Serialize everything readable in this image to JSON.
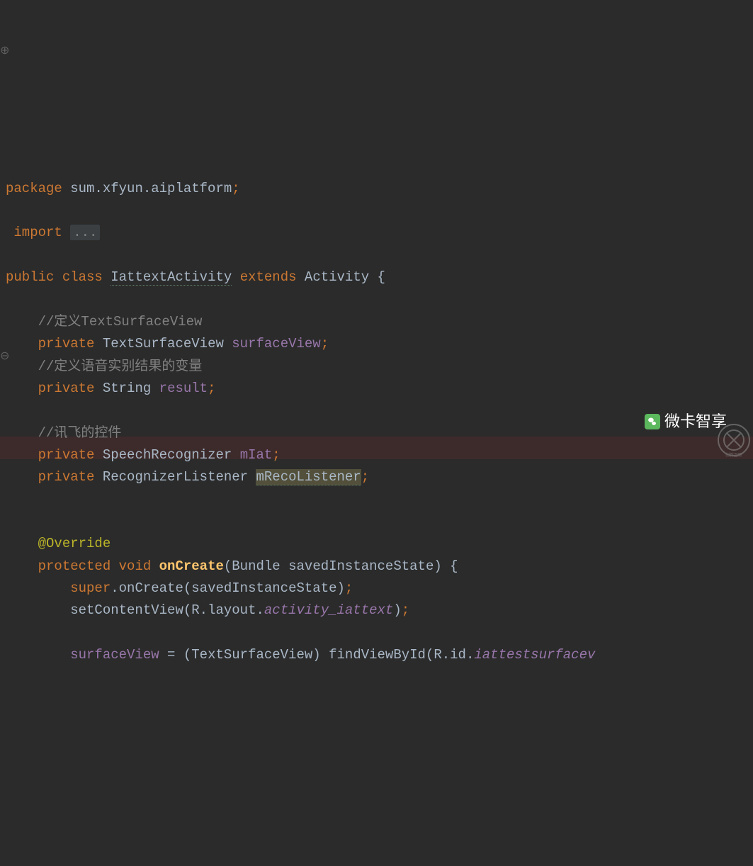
{
  "code": {
    "packageKw": "package",
    "packageName": " sum.xfyun.aiplatform",
    "importKw": "import",
    "importCollapsed": "...",
    "publicKw": "public",
    "classKw": "class",
    "className": "IattextActivity",
    "extendsKw": "extends",
    "superClass": "Activity",
    "comment1": "//定义TextSurfaceView",
    "privateKw": "private",
    "type1": "TextSurfaceView",
    "field1": "surfaceView",
    "comment2": "//定义语音实别结果的变量",
    "type2": "String",
    "field2": "result",
    "comment3": "//讯飞的控件",
    "type3": "SpeechRecognizer",
    "field3": "mIat",
    "type4": "RecognizerListener",
    "field4": "mRecoListener",
    "annotation": "@Override",
    "protectedKw": "protected",
    "voidKw": "void",
    "methodName": "onCreate",
    "paramType": "Bundle",
    "paramName": "savedInstanceState",
    "superKw": "super",
    "superCall": "onCreate",
    "superArg": "savedInstanceState",
    "setContentView": "setContentView",
    "rLayout": "R.layout.",
    "layoutName": "activity_iattext",
    "surfaceViewField": "surfaceView",
    "castType": "TextSurfaceView",
    "findViewById": "findViewById",
    "rId": "R.id.",
    "idName": "iattestsurfacev"
  },
  "watermark": {
    "text": "微卡智享",
    "brandText": "创新互联"
  }
}
